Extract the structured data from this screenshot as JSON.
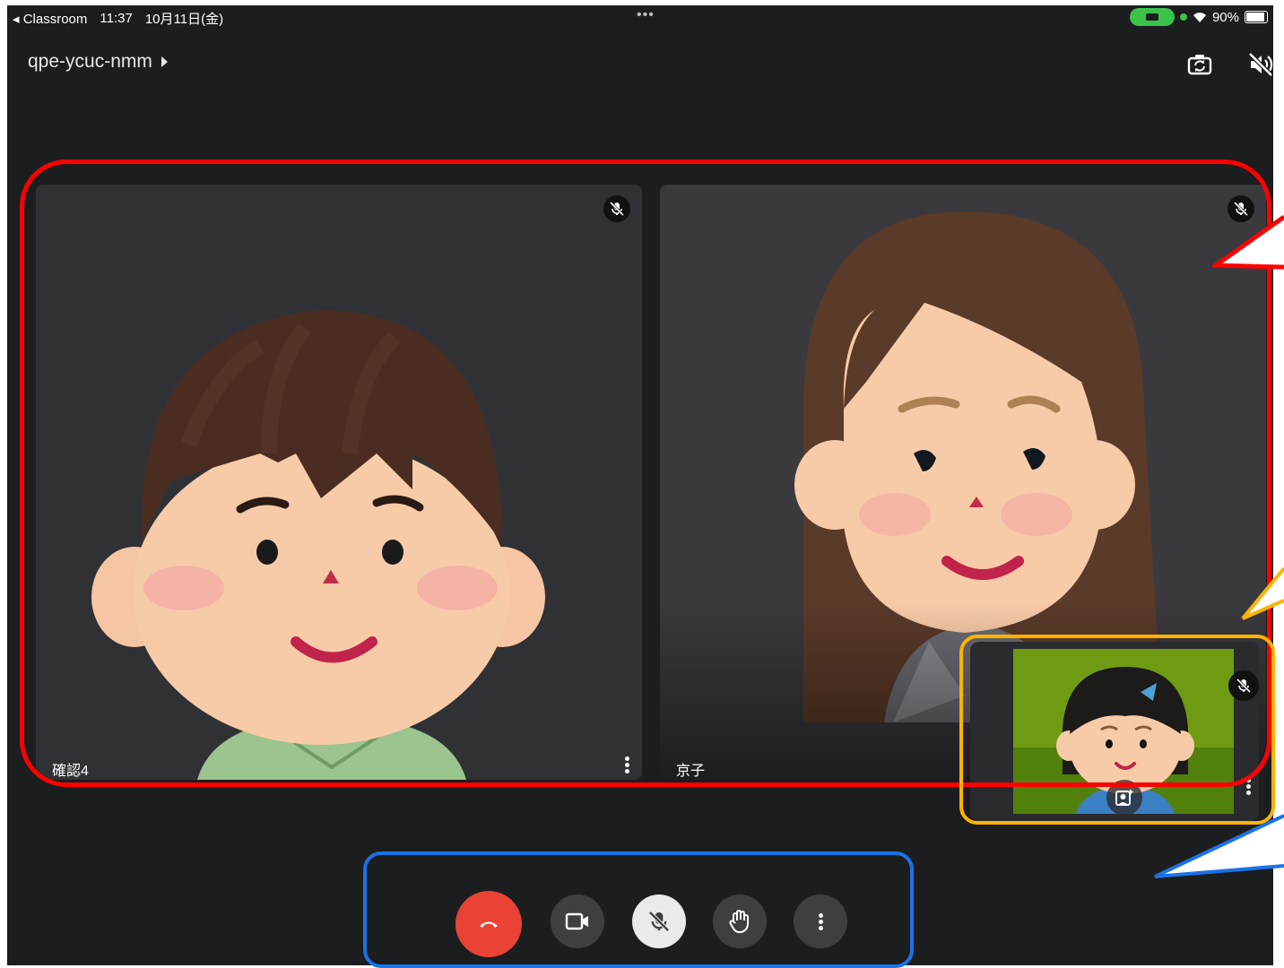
{
  "status_bar": {
    "back_app": "Classroom",
    "time": "11:37",
    "date": "10月11日(金)",
    "multitask": "•••",
    "battery": "90%"
  },
  "header": {
    "meeting_code": "qpe-ycuc-nmm",
    "icons": [
      "switch-camera-icon",
      "speaker-off-icon"
    ]
  },
  "participants": [
    {
      "name": "確認4",
      "muted": true,
      "avatar": "boy-avatar",
      "background": "#2f3134"
    },
    {
      "name": "京子",
      "muted": true,
      "avatar": "woman-avatar",
      "background": "#3a393e"
    }
  ],
  "self_view": {
    "muted": true,
    "avatar": "girl-avatar",
    "background": "#6f9b12",
    "icon": "background-effects-icon"
  },
  "controls": [
    {
      "name": "leave-call",
      "icon": "hang-up-icon",
      "color": "#ea4335"
    },
    {
      "name": "camera",
      "icon": "video-camera-icon",
      "color": "#3c4043"
    },
    {
      "name": "microphone",
      "icon": "mic-off-icon",
      "color": "#e8eaed"
    },
    {
      "name": "raise-hand",
      "icon": "hand-icon",
      "color": "#3c4043"
    },
    {
      "name": "more-options",
      "icon": "more-vert-icon",
      "color": "#3c4043"
    }
  ],
  "annotation_colors": {
    "participants": "#ff0000",
    "self_view": "#ffb300",
    "controls": "#1a73e8"
  }
}
